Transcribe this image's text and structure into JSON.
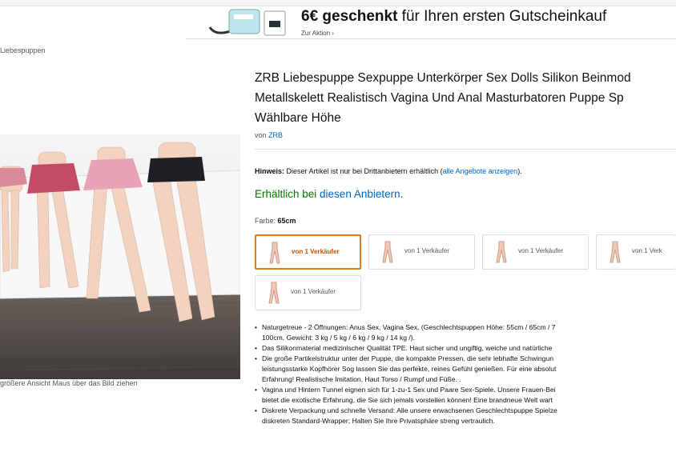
{
  "promo": {
    "amount": "6€ geschenkt",
    "rest": " für Ihren ersten Gutscheinkauf",
    "link": "Zur Aktion ›"
  },
  "breadcrumb": "Liebespuppen",
  "image_hint": "größere Ansicht Maus über das Bild ziehen",
  "product": {
    "title_lines": [
      "ZRB Liebespuppe Sexpuppe Unterkörper Sex Dolls Silikon Beinmod",
      "Metallskelett Realistisch Vagina Und Anal Masturbatoren Puppe Sp",
      "Wählbare Höhe"
    ],
    "by_label": "von",
    "brand": "ZRB"
  },
  "notice": {
    "label": "Hinweis:",
    "text": " Dieser Artikel ist nur bei Drittanbietern erhältlich (",
    "link": "alle Angebote anzeigen",
    "end": ")."
  },
  "availability": {
    "text": "Erhältlich bei ",
    "link": "diesen Anbietern",
    "end": "."
  },
  "color": {
    "label": "Farbe:",
    "value": "65cm"
  },
  "swatches": [
    {
      "label": "von 1 Verkäufer",
      "selected": true
    },
    {
      "label": "von 1 Verkäufer",
      "selected": false
    },
    {
      "label": "von 1 Verkäufer",
      "selected": false
    },
    {
      "label": "von 1 Verk",
      "selected": false
    },
    {
      "label": "von 1 Verkäufer",
      "selected": false
    }
  ],
  "bullets": [
    {
      "line": "Naturgetreue - 2 Öffnungen: Anus Sex, Vagina Sex. (Geschlechtspuppen Höhe: 55cm / 65cm / 7",
      "cont": [
        "100cm, Gewicht: 3 kg / 5 kg / 6 kg / 9 kg / 14 kg /)."
      ]
    },
    {
      "line": "Das Silikonmaterial medizinischer Qualität TPE. Haut sicher und ungiftig, weiche und natürliche",
      "cont": []
    },
    {
      "line": "Die große Partikelstruktur unter der Puppe, die kompakte Pressen, die sehr lebhafte Schwingun",
      "cont": [
        "leistungsstarke Kopfhörer Sog lassen Sie das perfekte, reines Gefühl genießen. Für eine absolut",
        "Erfahrung! Realistische Imitation, Haut Torso / Rumpf und Füße. ."
      ]
    },
    {
      "line": "Vagina und Hintern Tunnel eignen sich für 1-zu-1 Sex und Paare Sex-Spiele. Unsere Frauen-Bei",
      "cont": [
        "bietet die exotische Erfahrung, die Sie sich jemals vorstellen können! Eine brandneue Welt wart"
      ]
    },
    {
      "line": "Diskrete Verpackung und schnelle Versand: Alle unsere erwachsenen Geschlechtspuppe Spielze",
      "cont": [
        "diskreten Standard-Wrapper; Halten Sie Ihre Privatsphäre streng vertraulich."
      ]
    }
  ]
}
